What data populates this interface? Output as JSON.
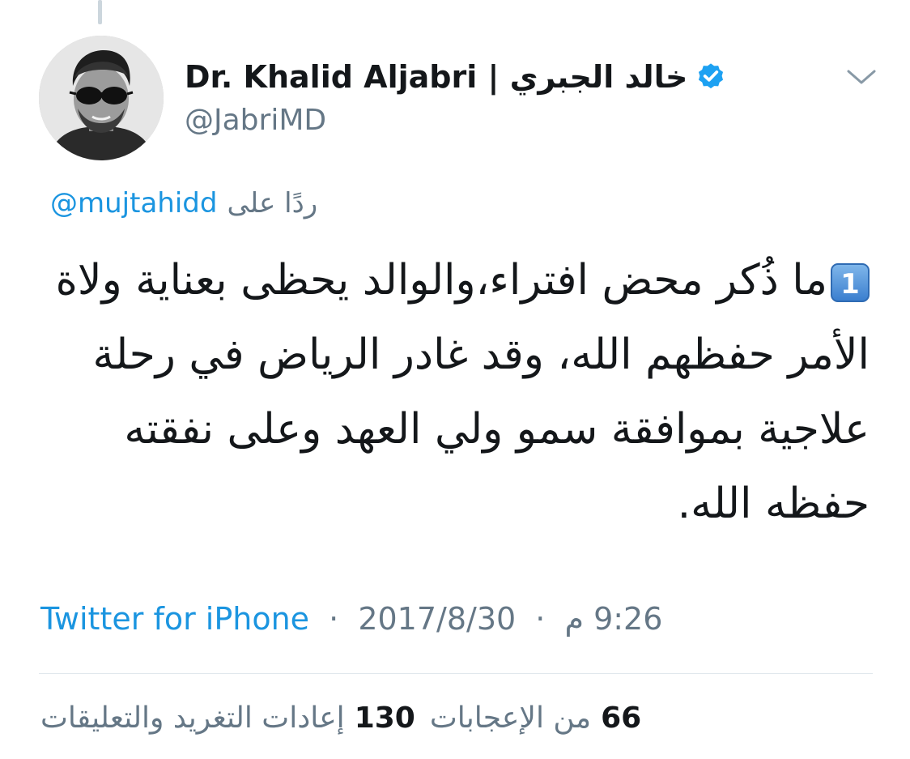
{
  "tweet": {
    "author": {
      "display_name": "Dr. Khalid Aljabri | خالد الجبري",
      "handle": "@JabriMD",
      "verified": true
    },
    "reply_to": {
      "label": "ردًا على",
      "mention": "@mujtahidd"
    },
    "body": {
      "number_badge": "1",
      "text": "ما ذُكر محض افتراء،والوالد يحظى بعناية ولاة الأمر حفظهم الله، وقد غادر الرياض في رحلة علاجية بموافقة سمو ولي العهد وعلى نفقته حفظه الله."
    },
    "meta": {
      "time": "9:26 م",
      "date": "2017/8/30",
      "source": "Twitter for iPhone",
      "separator": "·"
    },
    "stats": {
      "likes_count": "66",
      "likes_label": "من الإعجابات",
      "retweets_count": "130",
      "retweets_label": "إعادات التغريد والتعليقات"
    }
  },
  "colors": {
    "link_blue": "#1b95e0",
    "secondary_text": "#657786",
    "primary_text": "#14171a",
    "verified_blue": "#1da1f2",
    "divider": "#e1e8ed"
  },
  "icons": {
    "verified": "verified-badge-icon",
    "more": "chevron-down-icon",
    "avatar": "profile-photo"
  }
}
